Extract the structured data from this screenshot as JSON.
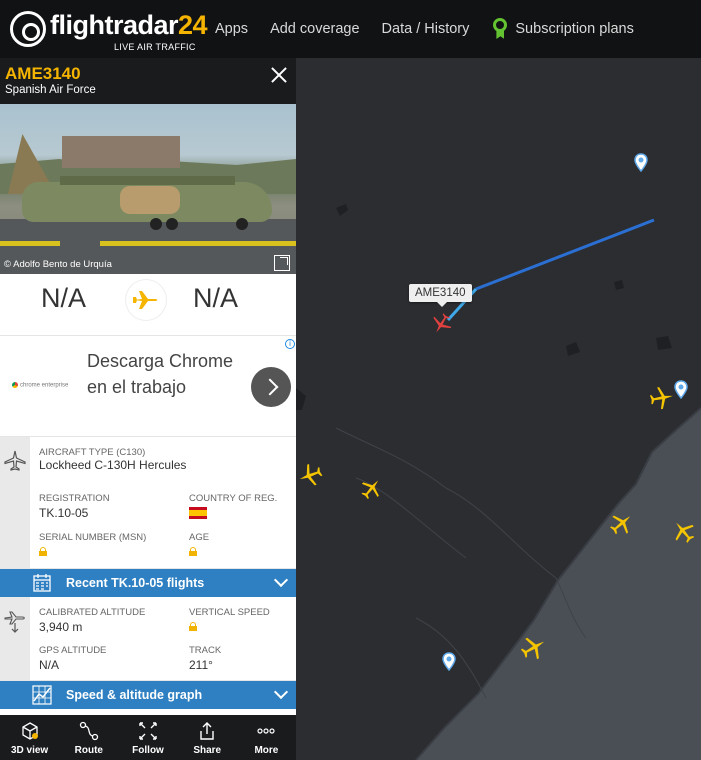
{
  "nav": {
    "logo_text": "flightradar",
    "logo_number": "24",
    "tagline": "LIVE AIR TRAFFIC",
    "links": [
      "Apps",
      "Add coverage",
      "Data / History",
      "Subscription plans"
    ]
  },
  "flight": {
    "callsign": "AME3140",
    "operator": "Spanish Air Force",
    "photo_credit": "© Adolfo Bento de Urquía",
    "origin": "N/A",
    "destination": "N/A"
  },
  "ad": {
    "brand": "chrome enterprise",
    "text": "Descarga Chrome en el trabajo",
    "info": "i"
  },
  "aircraft": {
    "type_label": "AIRCRAFT TYPE",
    "type_code": "(C130)",
    "type_value": "Lockheed C-130H Hercules",
    "registration_label": "REGISTRATION",
    "registration_value": "TK.10-05",
    "country_label": "COUNTRY OF REG.",
    "serial_label": "SERIAL NUMBER (MSN)",
    "age_label": "AGE"
  },
  "recent_bar": "Recent TK.10-05 flights",
  "altitude": {
    "cal_alt_label": "CALIBRATED ALTITUDE",
    "cal_alt_value": "3,940 m",
    "vs_label": "VERTICAL SPEED",
    "gps_label": "GPS ALTITUDE",
    "gps_value": "N/A",
    "track_label": "TRACK",
    "track_value": "211°"
  },
  "graph_bar": "Speed & altitude graph",
  "toolbar": [
    "3D view",
    "Route",
    "Follow",
    "Share",
    "More"
  ],
  "map": {
    "selected_label": "AME3140"
  },
  "colors": {
    "accent_yellow": "#f5b400",
    "bar_blue": "#2f80c2",
    "selected_red": "#e0413f",
    "track_blue": "#1e6fd0"
  }
}
